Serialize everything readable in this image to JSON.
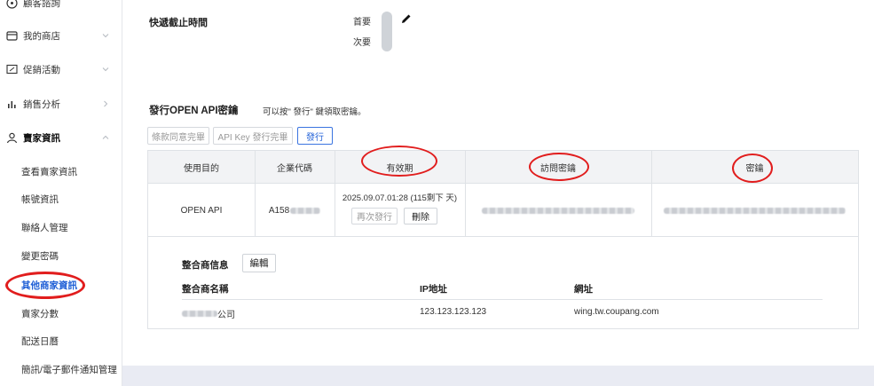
{
  "sidebar": {
    "items": [
      {
        "label": "顧客諮詢",
        "icon": "headset-icon",
        "chevron": false
      },
      {
        "label": "我的商店",
        "icon": "store-icon",
        "chevron": "down"
      },
      {
        "label": "促銷活動",
        "icon": "percent-coupon-icon",
        "chevron": "down"
      },
      {
        "label": "銷售分析",
        "icon": "bar-chart-icon",
        "chevron": "right"
      },
      {
        "label": "賣家資訊",
        "icon": "person-icon",
        "chevron": "up"
      }
    ],
    "sub_items": [
      "查看賣家資訊",
      "帳號資訊",
      "聯絡人管理",
      "變更密碼",
      "其他商家資訊",
      "賣家分數",
      "配送日曆",
      "簡訊/電子郵件通知管理"
    ],
    "active_sub": "其他商家資訊"
  },
  "cutoff": {
    "label": "快遞截止時間",
    "primary": "首要",
    "secondary": "次要"
  },
  "api": {
    "title": "發行OPEN API密鑰",
    "hint": "可以按\" 發行\" 鍵領取密鑰。",
    "btn_terms": "條款同意完畢",
    "btn_key": "API Key 發行完畢",
    "btn_issue": "發行",
    "headers": [
      "使用目的",
      "企業代碼",
      "有效期",
      "訪問密鑰",
      "密鑰"
    ],
    "row": {
      "purpose": "OPEN API",
      "code_prefix": "A158",
      "validity": "2025.09.07.01:28 (115剩下 天)",
      "btn_reissue": "再次發行",
      "btn_delete": "刪除"
    }
  },
  "integrator": {
    "label": "整合商信息",
    "edit": "編輯",
    "col_name": "整合商名稱",
    "col_ip": "IP地址",
    "col_url": "網址",
    "name_suffix": "公司",
    "ip": "123.123.123.123",
    "url": "wing.tw.coupang.com"
  },
  "colors": {
    "accent": "#2563d8",
    "annotation": "#e11d1d"
  }
}
